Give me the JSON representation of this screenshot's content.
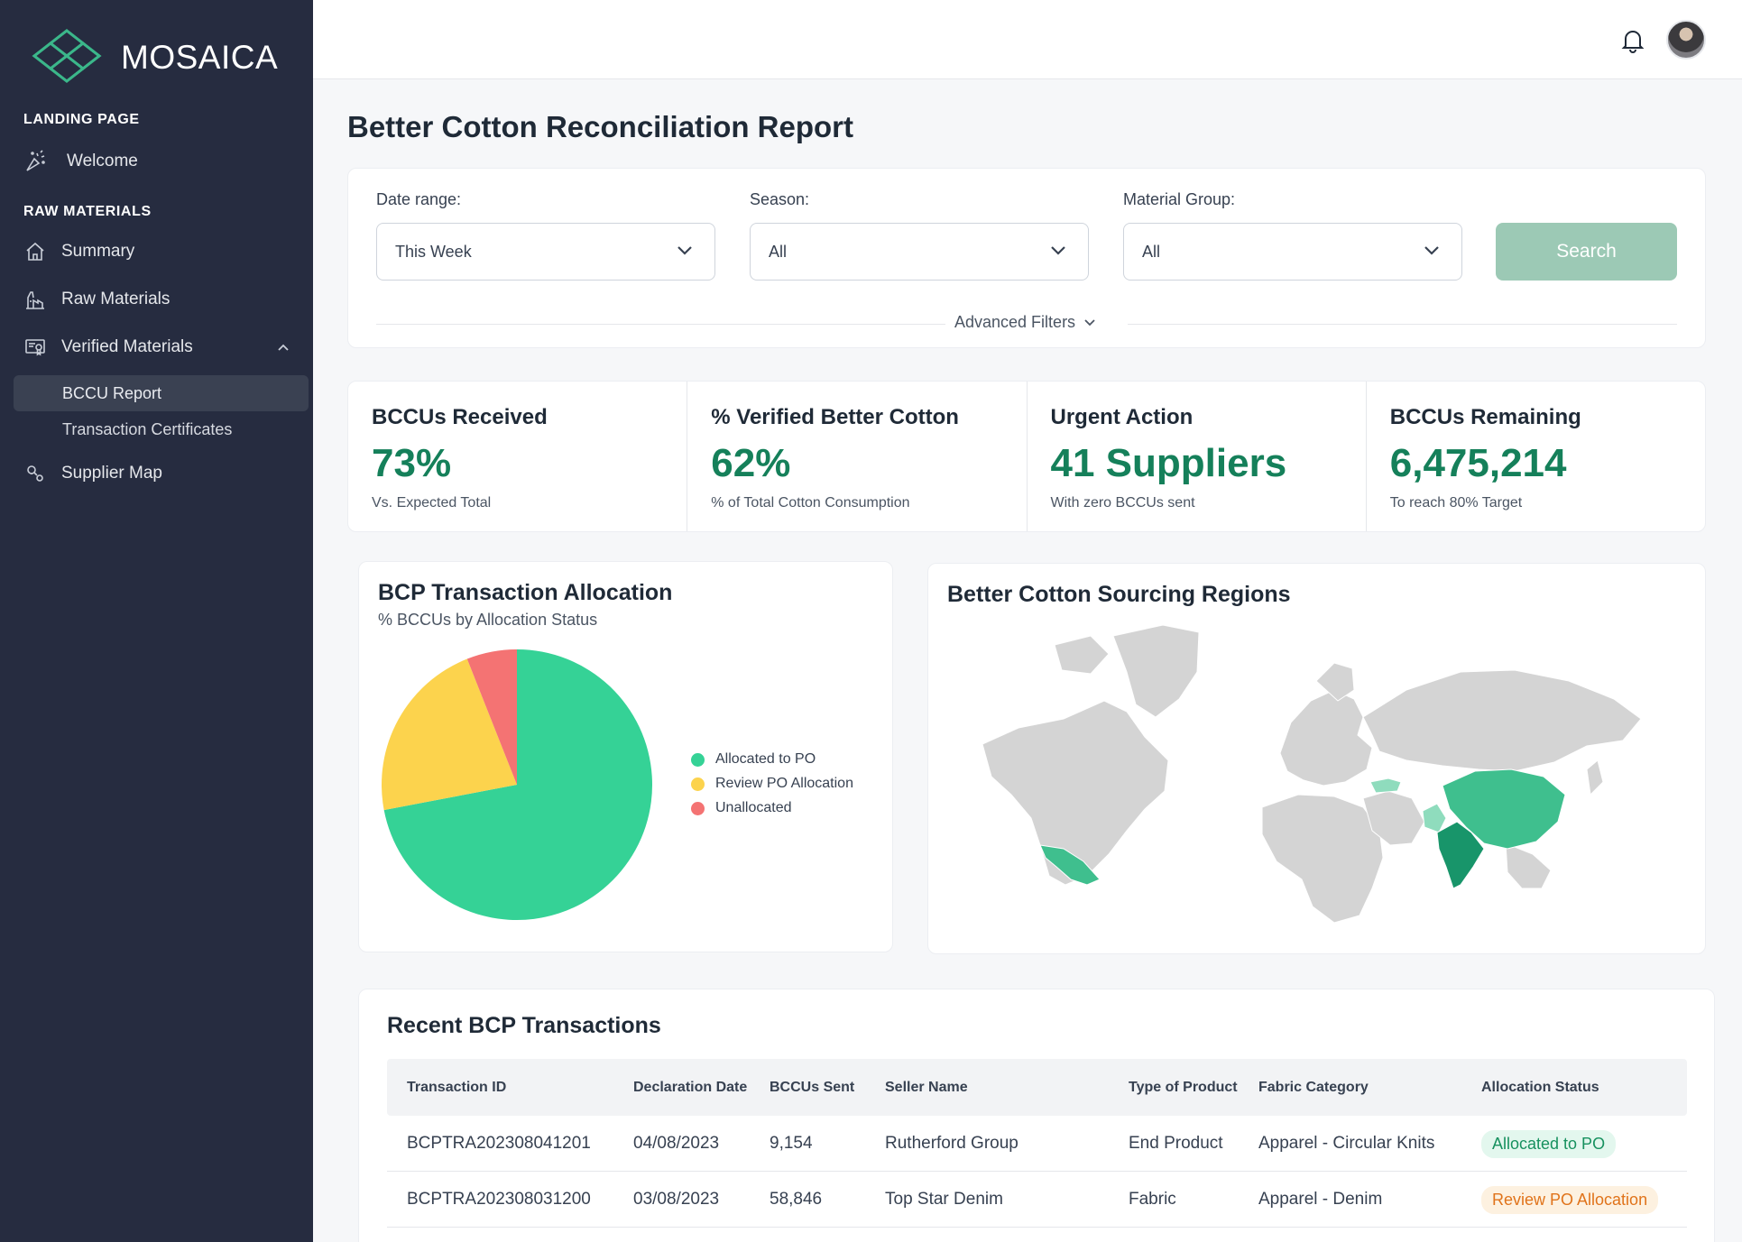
{
  "app": {
    "brand": "MOSAICA"
  },
  "sidebar": {
    "sections": [
      {
        "label": "LANDING PAGE"
      },
      {
        "label": "RAW MATERIALS"
      }
    ],
    "welcome": "Welcome",
    "items": [
      {
        "label": "Summary",
        "icon": "home-icon"
      },
      {
        "label": "Raw Materials",
        "icon": "factory-icon"
      },
      {
        "label": "Verified Materials",
        "icon": "certificate-icon",
        "expanded": true
      }
    ],
    "subitems": [
      {
        "label": "BCCU Report",
        "active": true
      },
      {
        "label": "Transaction Certificates",
        "active": false
      }
    ],
    "supplier_map": "Supplier Map"
  },
  "page": {
    "title": "Better Cotton Reconciliation Report"
  },
  "filters": {
    "date_range": {
      "label": "Date range:",
      "value": "This Week"
    },
    "season": {
      "label": "Season:",
      "value": "All"
    },
    "material_group": {
      "label": "Material Group:",
      "value": "All"
    },
    "search_label": "Search",
    "advanced_label": "Advanced Filters"
  },
  "kpis": [
    {
      "title": "BCCUs Received",
      "value": "73%",
      "sub": "Vs. Expected Total"
    },
    {
      "title": "% Verified Better Cotton",
      "value": "62%",
      "sub": "% of Total Cotton Consumption"
    },
    {
      "title": "Urgent Action",
      "value": "41 Suppliers",
      "sub": "With zero BCCUs sent"
    },
    {
      "title": "BCCUs Remaining",
      "value": "6,475,214",
      "sub": "To reach 80% Target"
    }
  ],
  "allocation": {
    "title": "BCP Transaction Allocation",
    "subtitle": "% BCCUs by Allocation Status"
  },
  "chart_data": {
    "type": "pie",
    "title": "BCP Transaction Allocation",
    "subtitle": "% BCCUs by Allocation Status",
    "categories": [
      "Allocated to PO",
      "Review PO Allocation",
      "Unallocated"
    ],
    "values": [
      72,
      22,
      6
    ],
    "colors": [
      "#35d296",
      "#fcd34d",
      "#f47373"
    ],
    "legend": "right"
  },
  "map": {
    "title": "Better Cotton Sourcing Regions",
    "base_color": "#d4d4d4",
    "highlight_colors": [
      "#3fbf8e",
      "#18956a",
      "#8fdcbd"
    ]
  },
  "table": {
    "title": "Recent BCP Transactions",
    "columns": [
      "Transaction ID",
      "Declaration Date",
      "BCCUs Sent",
      "Seller Name",
      "Type of Product",
      "Fabric Category",
      "Allocation Status"
    ],
    "rows": [
      [
        "BCPTRA202308041201",
        "04/08/2023",
        "9,154",
        "Rutherford Group",
        "End Product",
        "Apparel - Circular Knits",
        "Allocated to PO"
      ],
      [
        "BCPTRA202308031200",
        "03/08/2023",
        "58,846",
        "Top Star Denim",
        "Fabric",
        "Apparel - Denim",
        "Review PO Allocation"
      ]
    ],
    "status_colors": {
      "Allocated to PO": {
        "bg": "#e3f7ee",
        "fg": "#17915f"
      },
      "Review PO Allocation": {
        "bg": "#fdf1e0",
        "fg": "#e0731a"
      }
    }
  }
}
